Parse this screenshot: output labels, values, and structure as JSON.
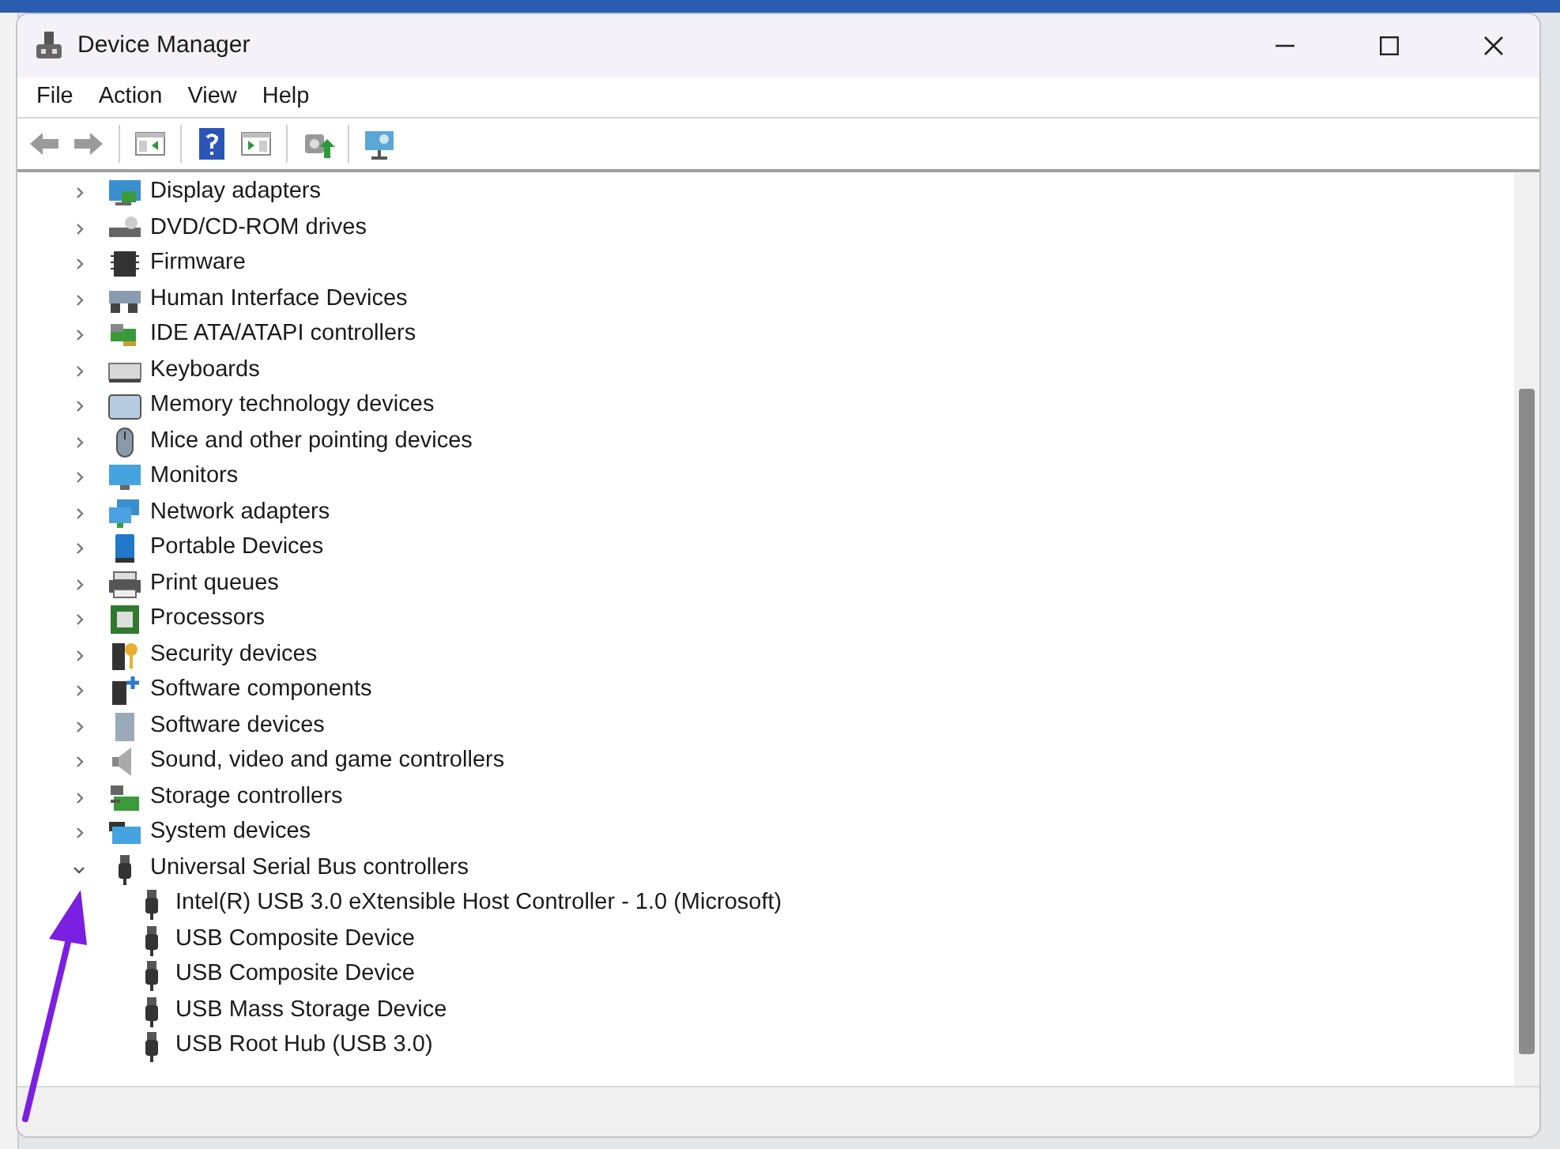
{
  "window": {
    "title": "Device Manager"
  },
  "menu": [
    "File",
    "Action",
    "View",
    "Help"
  ],
  "tree": {
    "items": [
      {
        "label": "Display adapters",
        "expanded": false
      },
      {
        "label": "DVD/CD-ROM drives",
        "expanded": false
      },
      {
        "label": "Firmware",
        "expanded": false
      },
      {
        "label": "Human Interface Devices",
        "expanded": false
      },
      {
        "label": "IDE ATA/ATAPI controllers",
        "expanded": false
      },
      {
        "label": "Keyboards",
        "expanded": false
      },
      {
        "label": "Memory technology devices",
        "expanded": false
      },
      {
        "label": "Mice and other pointing devices",
        "expanded": false
      },
      {
        "label": "Monitors",
        "expanded": false
      },
      {
        "label": "Network adapters",
        "expanded": false
      },
      {
        "label": "Portable Devices",
        "expanded": false
      },
      {
        "label": "Print queues",
        "expanded": false
      },
      {
        "label": "Processors",
        "expanded": false
      },
      {
        "label": "Security devices",
        "expanded": false
      },
      {
        "label": "Software components",
        "expanded": false
      },
      {
        "label": "Software devices",
        "expanded": false
      },
      {
        "label": "Sound, video and game controllers",
        "expanded": false
      },
      {
        "label": "Storage controllers",
        "expanded": false
      },
      {
        "label": "System devices",
        "expanded": false
      },
      {
        "label": "Universal Serial Bus controllers",
        "expanded": true,
        "children": [
          {
            "label": "Intel(R) USB 3.0 eXtensible Host Controller - 1.0 (Microsoft)"
          },
          {
            "label": "USB Composite Device"
          },
          {
            "label": "USB Composite Device"
          },
          {
            "label": "USB Mass Storage Device"
          },
          {
            "label": "USB Root Hub (USB 3.0)"
          }
        ]
      }
    ]
  }
}
